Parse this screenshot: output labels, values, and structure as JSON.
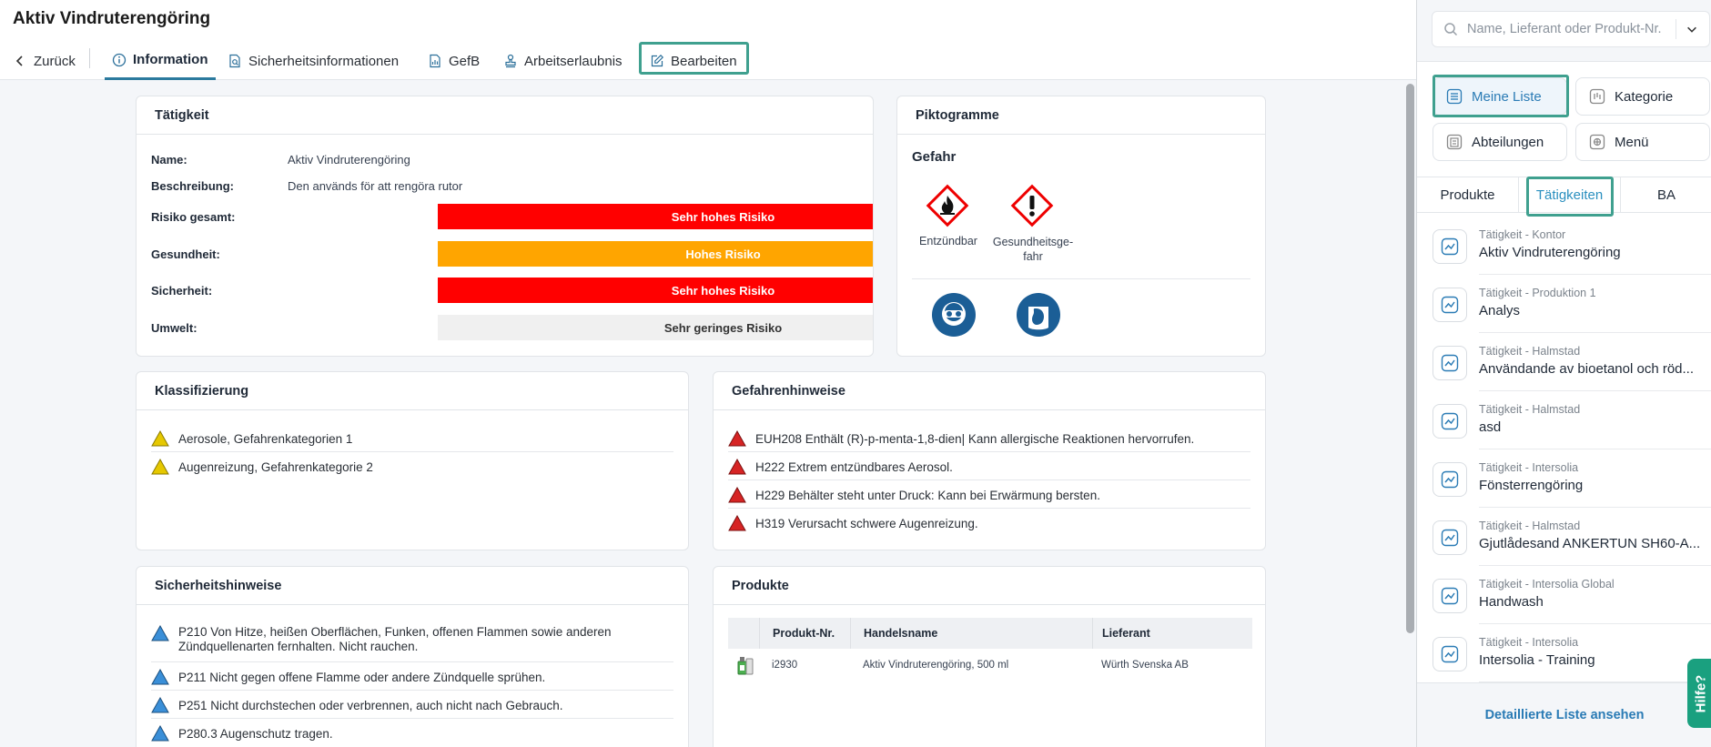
{
  "page": {
    "title": "Aktiv Vindruterengöring",
    "tabs": [
      {
        "label": "Zurück",
        "icon": "chevron-left-icon"
      },
      {
        "label": "Information",
        "icon": "info-icon"
      },
      {
        "label": "Sicherheitsinformationen",
        "icon": "document-search-icon"
      },
      {
        "label": "GefB",
        "icon": "document-chart-icon"
      },
      {
        "label": "Arbeitserlaubnis",
        "icon": "stamp-icon"
      },
      {
        "label": "Bearbeiten",
        "icon": "edit-icon"
      }
    ]
  },
  "taetigkeit": {
    "heading": "Tätigkeit",
    "name_label": "Name:",
    "name_value": "Aktiv Vindruterengöring",
    "desc_label": "Beschreibung:",
    "desc_value": "Den används för att rengöra rutor",
    "risk_total_label": "Risiko gesamt:",
    "risk_total_value": "Sehr hohes Risiko",
    "health_label": "Gesundheit:",
    "health_value": "Hohes Risiko",
    "safety_label": "Sicherheit:",
    "safety_value": "Sehr hohes Risiko",
    "env_label": "Umwelt:",
    "env_value": "Sehr geringes Risiko",
    "colors": {
      "very_high": "#ff0000",
      "high": "#ffa500",
      "very_low": "#f0f0f0"
    }
  },
  "piktogramme": {
    "heading": "Piktogramme",
    "signal_word": "Gefahr",
    "ghs": [
      {
        "label": "Entzündbar",
        "icon": "flame-pictogram-icon"
      },
      {
        "label": "Gesundheitsge-fahr",
        "icon": "exclamation-pictogram-icon"
      }
    ],
    "ppe": [
      {
        "icon": "goggles-required-icon"
      },
      {
        "icon": "face-shield-required-icon"
      }
    ]
  },
  "klassifizierung": {
    "heading": "Klassifizierung",
    "items": [
      "Aerosole, Gefahrenkategorien 1",
      "Augenreizung, Gefahrenkategorie 2"
    ]
  },
  "gefahrenhinweise": {
    "heading": "Gefahrenhinweise",
    "items": [
      "EUH208 Enthält (R)-p-menta-1,8-dien| Kann allergische Reaktionen hervorrufen.",
      "H222 Extrem entzündbares Aerosol.",
      "H229 Behälter steht unter Druck: Kann bei Erwärmung bersten.",
      "H319 Verursacht schwere Augenreizung."
    ]
  },
  "sicherheitshinweise": {
    "heading": "Sicherheitshinweise",
    "items": [
      "P210 Von Hitze, heißen Oberflächen, Funken, offenen Flammen sowie anderen Zündquellenarten fernhalten. Nicht rauchen.",
      "P211 Nicht gegen offene Flamme oder andere Zündquelle sprühen.",
      "P251 Nicht durchstechen oder verbrennen, auch nicht nach Gebrauch.",
      "P280.3 Augenschutz tragen."
    ]
  },
  "produkte": {
    "heading": "Produkte",
    "columns": [
      "Produkt-Nr.",
      "Handelsname",
      "Lieferant"
    ],
    "rows": [
      {
        "nr": "i2930",
        "name": "Aktiv Vindruterengöring, 500 ml",
        "supplier": "Würth Svenska AB",
        "icon": "product-spray-icon"
      }
    ]
  },
  "sidebar": {
    "search_placeholder": "Name, Lieferant oder Produkt-Nr.",
    "quick": [
      {
        "label": "Meine Liste",
        "icon": "list-icon",
        "selected": true
      },
      {
        "label": "Kategorie",
        "icon": "category-icon",
        "selected": false
      },
      {
        "label": "Abteilungen",
        "icon": "departments-icon",
        "selected": false
      },
      {
        "label": "Menü",
        "icon": "menu-grid-icon",
        "selected": false
      }
    ],
    "segments": [
      "Produkte",
      "Tätigkeiten",
      "BA"
    ],
    "active_segment": "Tätigkeiten",
    "activities": [
      {
        "category": "Tätigkeit - Kontor",
        "name": "Aktiv Vindruterengöring"
      },
      {
        "category": "Tätigkeit - Produktion 1",
        "name": "Analys"
      },
      {
        "category": "Tätigkeit - Halmstad",
        "name": "Användande av bioetanol och röd..."
      },
      {
        "category": "Tätigkeit - Halmstad",
        "name": "asd"
      },
      {
        "category": "Tätigkeit - Intersolia",
        "name": "Fönsterrengöring"
      },
      {
        "category": "Tätigkeit - Halmstad",
        "name": "Gjutlådesand ANKERTUN SH60-A..."
      },
      {
        "category": "Tätigkeit - Intersolia Global",
        "name": "Handwash"
      },
      {
        "category": "Tätigkeit - Intersolia",
        "name": "Intersolia - Training"
      }
    ],
    "footer_link": "Detaillierte Liste ansehen",
    "help_label": "Hilfe?"
  },
  "accent_color": "#3fa08f",
  "link_color": "#2a7bb5"
}
